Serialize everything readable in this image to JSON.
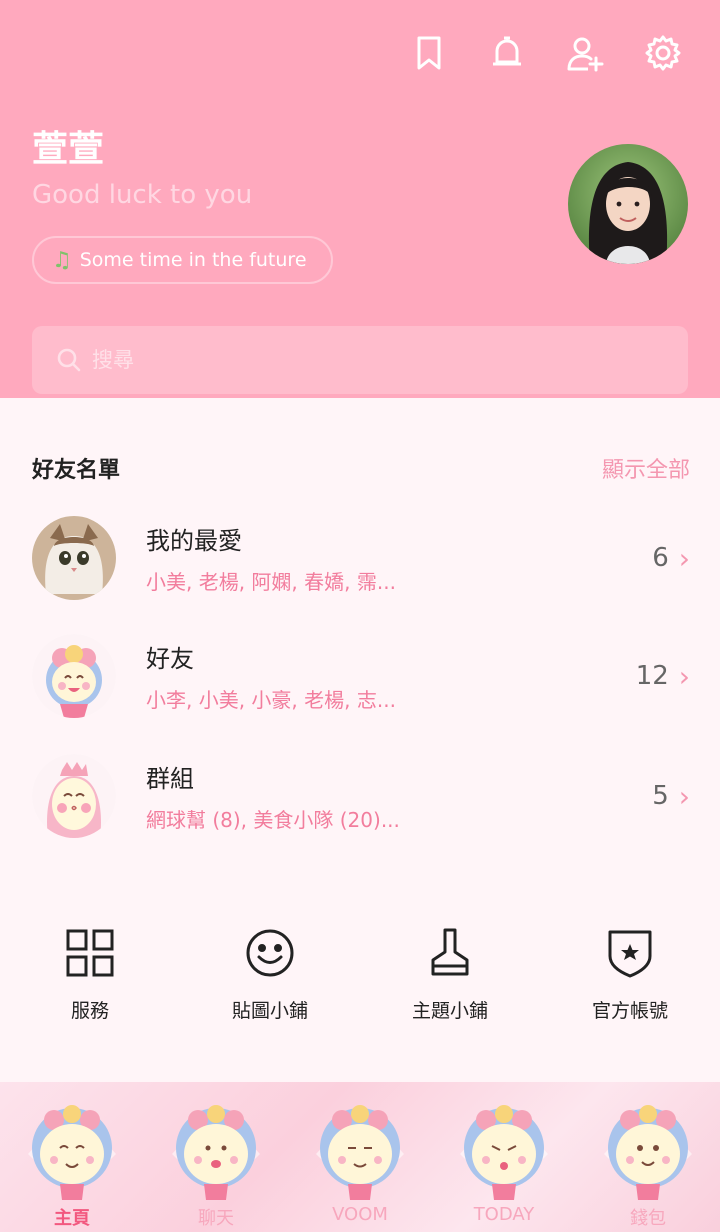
{
  "header": {
    "icons": [
      "bookmark-icon",
      "bell-icon",
      "add-friend-icon",
      "settings-icon"
    ],
    "name": "萱萱",
    "status": "Good luck to you",
    "music": "Some time in the future"
  },
  "search": {
    "placeholder": "搜尋"
  },
  "friends": {
    "title": "好友名單",
    "show_all": "顯示全部",
    "rows": [
      {
        "name": "我的最愛",
        "members": "小美, 老楊, 阿嫻, 春嬌, 霈...",
        "count": "6"
      },
      {
        "name": "好友",
        "members": "小李, 小美, 小豪, 老楊, 志...",
        "count": "12"
      },
      {
        "name": "群組",
        "members": "網球幫 (8), 美食小隊 (20)...",
        "count": "5"
      }
    ]
  },
  "services": [
    {
      "label": "服務",
      "icon": "grid-icon"
    },
    {
      "label": "貼圖小鋪",
      "icon": "smiley-icon"
    },
    {
      "label": "主題小鋪",
      "icon": "brush-icon"
    },
    {
      "label": "官方帳號",
      "icon": "shield-star-icon"
    }
  ],
  "nav": [
    {
      "label": "主頁",
      "active": true
    },
    {
      "label": "聊天",
      "active": false
    },
    {
      "label": "VOOM",
      "active": false
    },
    {
      "label": "TODAY",
      "active": false
    },
    {
      "label": "錢包",
      "active": false
    }
  ],
  "colors": {
    "header": "#ffa9be",
    "accent": "#f27d9d",
    "body": "#fff5f8"
  }
}
